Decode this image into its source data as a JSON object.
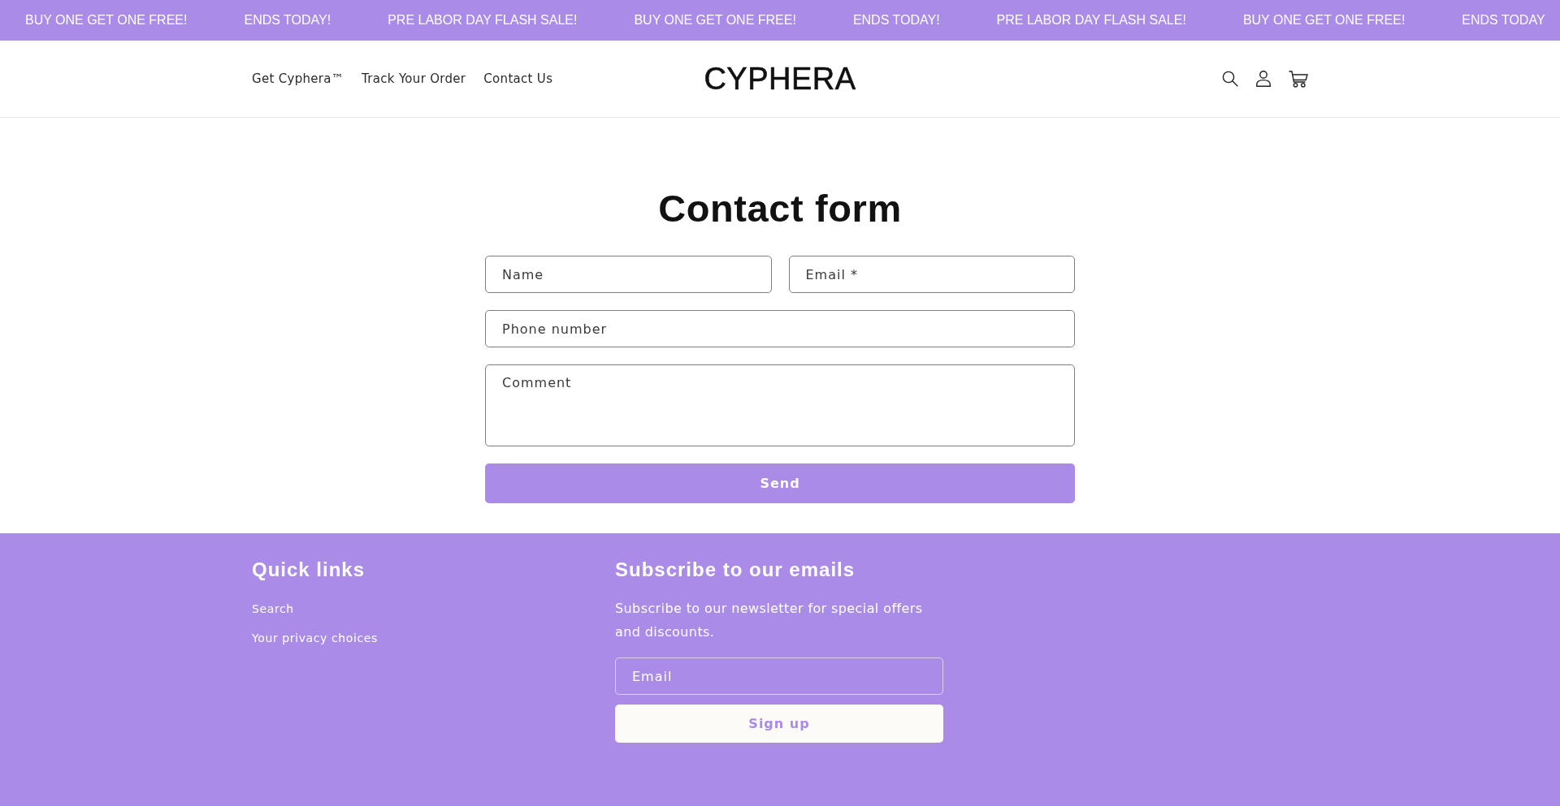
{
  "announcement_bar": {
    "messages": [
      "BUY ONE GET ONE FREE!",
      "ENDS TODAY!",
      "PRE LABOR DAY FLASH SALE!",
      "BUY ONE GET ONE FREE!",
      "ENDS TODAY!",
      "PRE LABOR DAY FLASH SALE!",
      "BUY ONE GET ONE FREE!",
      "ENDS TODAY"
    ]
  },
  "header": {
    "nav_links": [
      "Get Cyphera™",
      "Track Your Order",
      "Contact Us"
    ],
    "logo": "CYPHERA",
    "icons": [
      {
        "kind": "search"
      },
      {
        "kind": "account"
      },
      {
        "kind": "cart"
      }
    ]
  },
  "contact_form": {
    "title": "Contact form",
    "rows": [
      [
        {
          "kind": "input",
          "placeholder": "Name"
        },
        {
          "kind": "input",
          "placeholder": "Email *"
        }
      ],
      [
        {
          "kind": "input",
          "placeholder": "Phone number"
        }
      ],
      [
        {
          "kind": "textarea",
          "placeholder": "Comment"
        }
      ]
    ],
    "submit": "Send"
  },
  "footer": {
    "quick_links": {
      "title": "Quick links",
      "links": [
        "Search",
        "Your privacy choices"
      ]
    },
    "newsletter": {
      "title": "Subscribe to our emails",
      "text": "Subscribe to our newsletter for special offers and discounts.",
      "email_placeholder": "Email",
      "button": "Sign up"
    }
  }
}
